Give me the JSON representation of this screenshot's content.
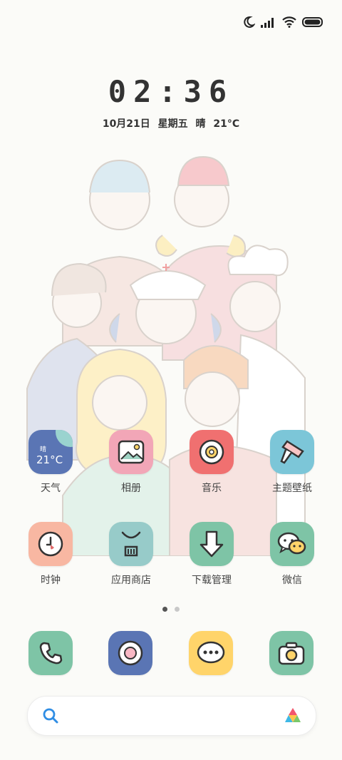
{
  "status_bar": {
    "icons": [
      "moon-icon",
      "signal-icon",
      "wifi-icon",
      "battery-icon"
    ]
  },
  "clock": {
    "time": "02:36"
  },
  "date_line": "10月21日  星期五  晴  21°C",
  "weather_widget": {
    "condition": "晴",
    "temperature": "21°C"
  },
  "apps": [
    {
      "label": "天气"
    },
    {
      "label": "相册"
    },
    {
      "label": "音乐"
    },
    {
      "label": "主题壁纸"
    },
    {
      "label": "时钟"
    },
    {
      "label": "应用商店"
    },
    {
      "label": "下载管理"
    },
    {
      "label": "微信"
    }
  ],
  "page_indicator": {
    "current": 1,
    "total": 2
  },
  "dock": [
    "phone-icon",
    "browser-icon",
    "messages-icon",
    "camera-icon"
  ],
  "colors": {
    "weather": "#5a75b4",
    "gallery": "#f2a6b7",
    "music": "#f07070",
    "themes": "#7cc6d8",
    "clock": "#f8b7a2",
    "store": "#97cbc9",
    "downloads": "#7ec4a6",
    "wechat": "#7ec4a6",
    "phone": "#7ec4a6",
    "browser": "#5a75b4",
    "messages": "#ffd46a",
    "camera": "#7ec4a6"
  }
}
